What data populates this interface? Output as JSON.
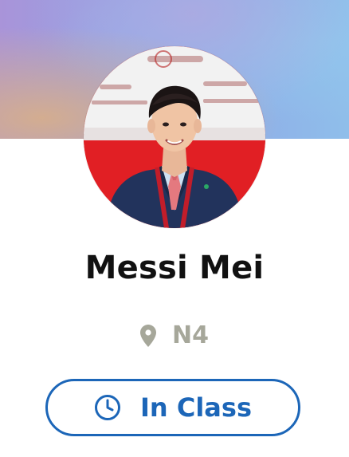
{
  "profile": {
    "name": "Messi Mei",
    "location": "N4",
    "status_button_label": "In Class"
  },
  "icons": {
    "location": "map-pin-icon",
    "status": "clock-icon"
  },
  "colors": {
    "accent": "#1c66b8",
    "muted_location": "#a6a79a",
    "name_text": "#111111"
  }
}
